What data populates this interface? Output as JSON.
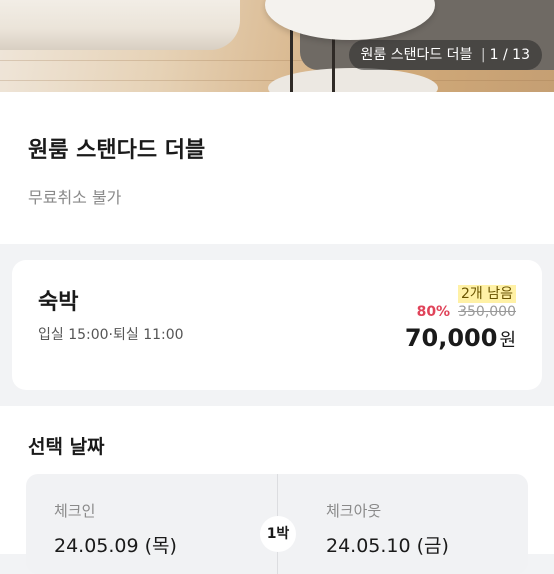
{
  "gallery": {
    "room_name": "원룸 스탠다드 더블",
    "current": "1",
    "total": "13",
    "separator": "|",
    "slash": "/"
  },
  "room": {
    "title": "원룸 스탠다드 더블",
    "cancel_policy": "무료취소 불가"
  },
  "stay": {
    "label": "숙박",
    "times": "입실 15:00·퇴실 11:00",
    "remaining": "2개 남음",
    "discount": "80%",
    "original_price": "350,000",
    "final_price": "70,000",
    "currency_unit": "원"
  },
  "dates": {
    "heading": "선택 날짜",
    "checkin_label": "체크인",
    "checkin_value": "24.05.09 (목)",
    "checkout_label": "체크아웃",
    "checkout_value": "24.05.10 (금)",
    "nights": "1박"
  },
  "colors": {
    "discount": "#e0445a",
    "remaining_bg": "#fff1a6",
    "background": "#f2f3f5"
  }
}
